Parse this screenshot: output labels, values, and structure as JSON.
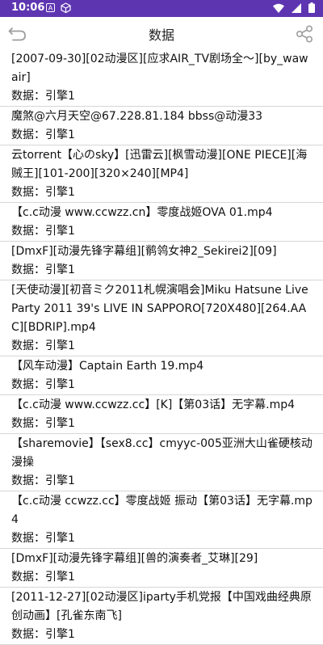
{
  "status_bar": {
    "time": "10:06",
    "left_icons": [
      "a-icon",
      "cube-icon"
    ],
    "right_icons": [
      "wifi-icon",
      "cellular-icon",
      "battery-icon"
    ]
  },
  "app_bar": {
    "title": "数据",
    "back_icon": "back-icon",
    "share_icon": "share-icon"
  },
  "items": [
    {
      "name": "[2007-09-30][02动漫区][应求AIR_TV剧场全～][by_wawair]",
      "meta": "数据：引擎1"
    },
    {
      "name": "魔煞@六月天空@67.228.81.184 bbss@动漫33",
      "meta": "数据：引擎1"
    },
    {
      "name": "云torrent【心のsky】[迅雷云][枫雪动漫][ONE PIECE][海贼王][101-200][320×240][MP4]",
      "meta": "数据：引擎1"
    },
    {
      "name": "【c.c动漫 www.ccwzz.cn】零度战姬OVA 01.mp4",
      "meta": "数据：引擎1"
    },
    {
      "name": "[DmxF][动漫先锋字幕组][鹡鸰女神2_Sekirei2][09]",
      "meta": "数据：引擎1"
    },
    {
      "name": "[天使动漫][初音ミク2011札幌演唱会]Miku Hatsune Live Party 2011 39's LIVE IN SAPPORO[720X480][264.AAC][BDRIP].mp4",
      "meta": "数据：引擎1"
    },
    {
      "name": "【风车动漫】Captain Earth 19.mp4",
      "meta": "数据：引擎1"
    },
    {
      "name": "【c.c动漫 www.ccwzz.cc】[K]【第03话】无字幕.mp4",
      "meta": "数据：引擎1"
    },
    {
      "name": "【sharemovie】【sex8.cc】cmyyc-005亚洲大山雀硬核动漫操",
      "meta": "数据：引擎1"
    },
    {
      "name": "【c.c动漫 ccwzz.cc】零度战姬 振动【第03话】无字幕.mp4",
      "meta": "数据：引擎1"
    },
    {
      "name": "[DmxF][动漫先锋字幕组][兽的演奏者_艾琳][29]",
      "meta": "数据：引擎1"
    },
    {
      "name": "[2011-12-27][02动漫区]iparty手机党报【中国戏曲经典原创动画】[孔雀东南飞]",
      "meta": "数据：引擎1"
    }
  ]
}
